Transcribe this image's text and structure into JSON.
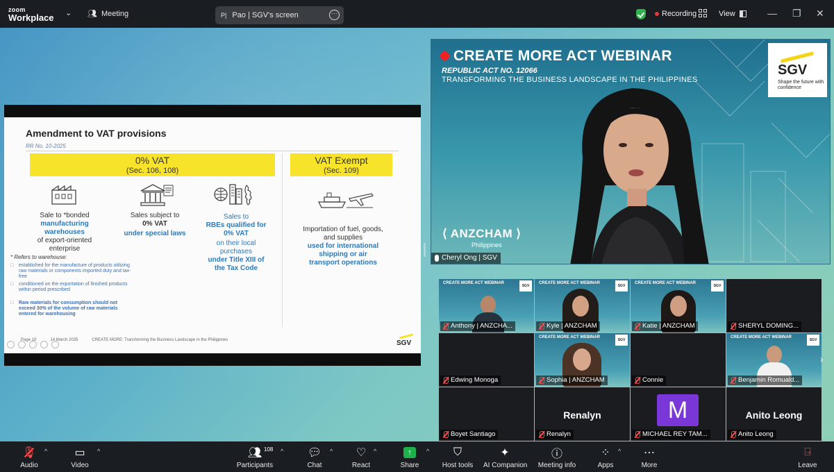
{
  "titlebar": {
    "logo_top": "zoom",
    "logo_bottom": "Workplace",
    "meeting_label": "Meeting",
    "screen_label": "Pao | SGV's screen",
    "recording_label": "Recording",
    "view_label": "View"
  },
  "slide": {
    "title": "Amendment to VAT provisions",
    "rr": "RR No. 10-2025",
    "zero_vat_title": "0% VAT",
    "zero_vat_sec": "(Sec. 106, 108)",
    "exempt_title": "VAT Exempt",
    "exempt_sec": "(Sec. 109)",
    "col1_a": "Sale to *bonded",
    "col1_b": "manufacturing warehouses",
    "col1_c": "of export-oriented enterprise",
    "col2_a": "Sales subject to",
    "col2_b": "0% VAT",
    "col2_c": "under special laws",
    "col3_a": "Sales to",
    "col3_b": "RBEs qualified for 0% VAT",
    "col3_c": "on their local purchases",
    "col3_d": "under Title XIII of the Tax Code",
    "col4_a": "Importation of fuel, goods, and supplies",
    "col4_b": "used for international shipping or air transport operations",
    "note": "* Refers to warehouse:",
    "bullets": [
      "established for the manufacture of products utilizing raw materials or components imported duty and tax-free",
      "conditioned on the exportation of finished products within period prescribed",
      "Raw materials for consumption should not exceed 30% of the volume of raw materials entered for warehousing"
    ],
    "footer_page": "Page 10",
    "footer_date": "14 March 2025",
    "footer_text": "CREATE MORE: Transforming the Business Landscape in the Philippines",
    "footer_logo": "SGV"
  },
  "speaker": {
    "title": "CREATE MORE ACT WEBINAR",
    "sub1": "REPUBLIC ACT NO. 12066",
    "sub2": "TRANSFORMING THE BUSINESS LANDSCAPE IN THE PHILIPPINES",
    "sgv": "SGV",
    "sgv_tag": "Shape the future with confidence",
    "anzcham": "ANZCHAM",
    "anzcham_sub": "Philippines",
    "name": "Cheryl Ong | SGV"
  },
  "gallery": {
    "tile_title": "CREATE MORE ACT WEBINAR",
    "tile_sgv": "SGV",
    "tiles": [
      {
        "name": "Anthony | ANZCHA..."
      },
      {
        "name": "Kyle | ANZCHAM"
      },
      {
        "name": "Katie | ANZCHAM"
      },
      {
        "name": "SHERYL DOMING..."
      },
      {
        "name": "Edwing Monoga"
      },
      {
        "name": "Sophia | ANZCHAM"
      },
      {
        "name": "Connie"
      },
      {
        "name": "Benjamin Romuald..."
      },
      {
        "name": "Boyet Santiago"
      },
      {
        "name": "Renalyn",
        "big": "Renalyn"
      },
      {
        "name": "MICHAEL REY TAM...",
        "avatar": "M"
      },
      {
        "name": "Anito Leong",
        "big": "Anito Leong"
      }
    ]
  },
  "toolbar": {
    "audio": "Audio",
    "video": "Video",
    "participants": "Participants",
    "participants_count": "108",
    "chat": "Chat",
    "react": "React",
    "share": "Share",
    "host_tools": "Host tools",
    "ai_companion": "AI Companion",
    "meeting_info": "Meeting info",
    "apps": "Apps",
    "more": "More",
    "leave": "Leave"
  },
  "colors": {
    "accent_yellow": "#f7e32a",
    "slide_blue": "#2f79b6",
    "share_green": "#1fb24b",
    "recording_red": "#e03a3a"
  }
}
